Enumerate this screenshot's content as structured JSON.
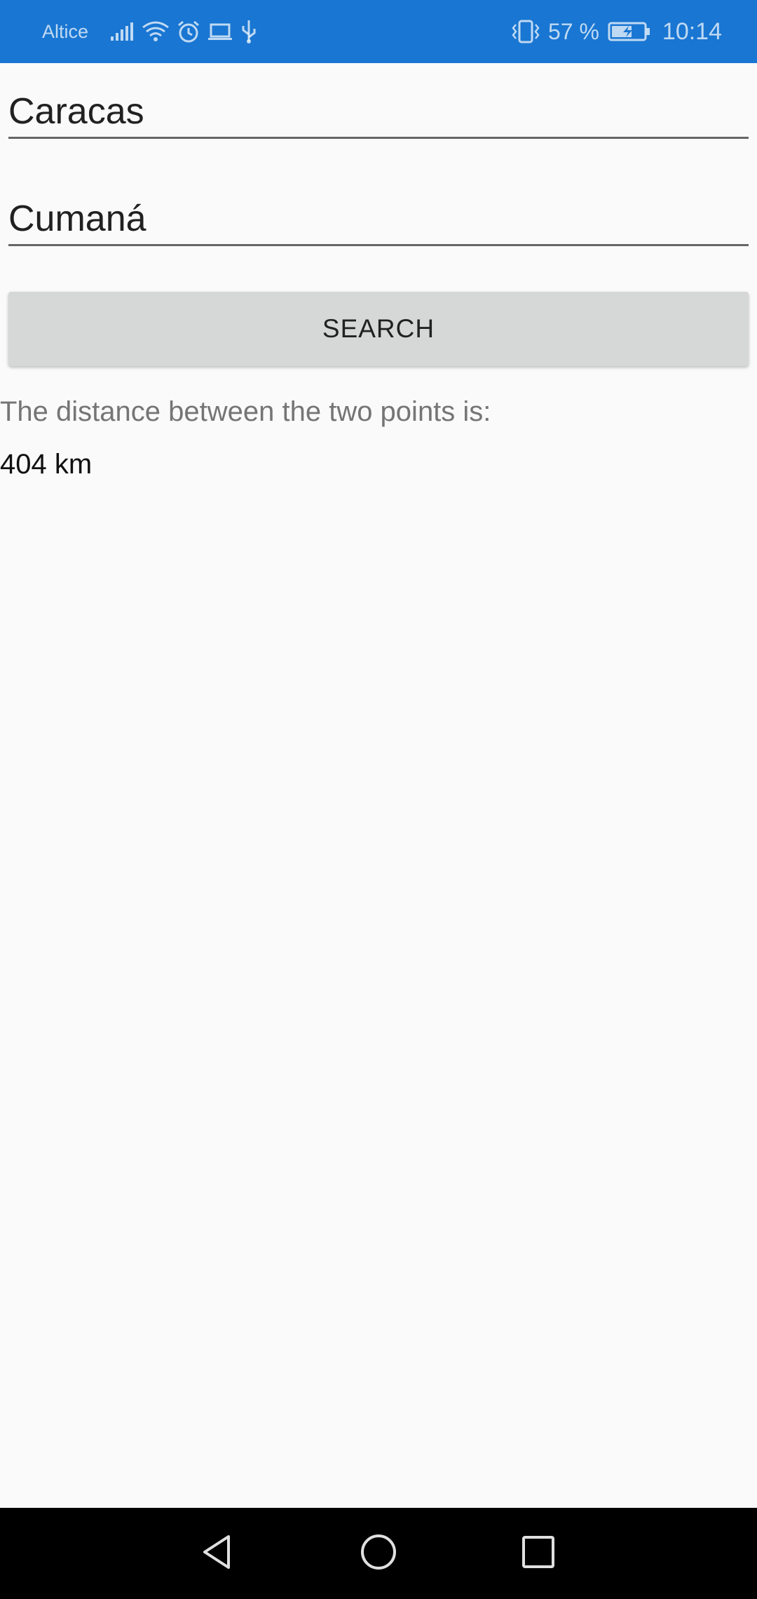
{
  "status_bar": {
    "carrier": "Altice",
    "battery_percent": "57 %",
    "time": "10:14",
    "icons": [
      "signal-icon",
      "wifi-icon",
      "alarm-icon",
      "laptop-icon",
      "usb-icon",
      "vibrate-icon",
      "battery-charging-icon"
    ],
    "background": "#1976d2"
  },
  "form": {
    "origin_value": "Caracas",
    "destination_value": "Cumaná",
    "search_label": "SEARCH"
  },
  "result": {
    "label": "The distance between the two points is:",
    "value": "404 km"
  },
  "nav_bar": {
    "icons": [
      "back-icon",
      "home-icon",
      "recent-apps-icon"
    ]
  }
}
